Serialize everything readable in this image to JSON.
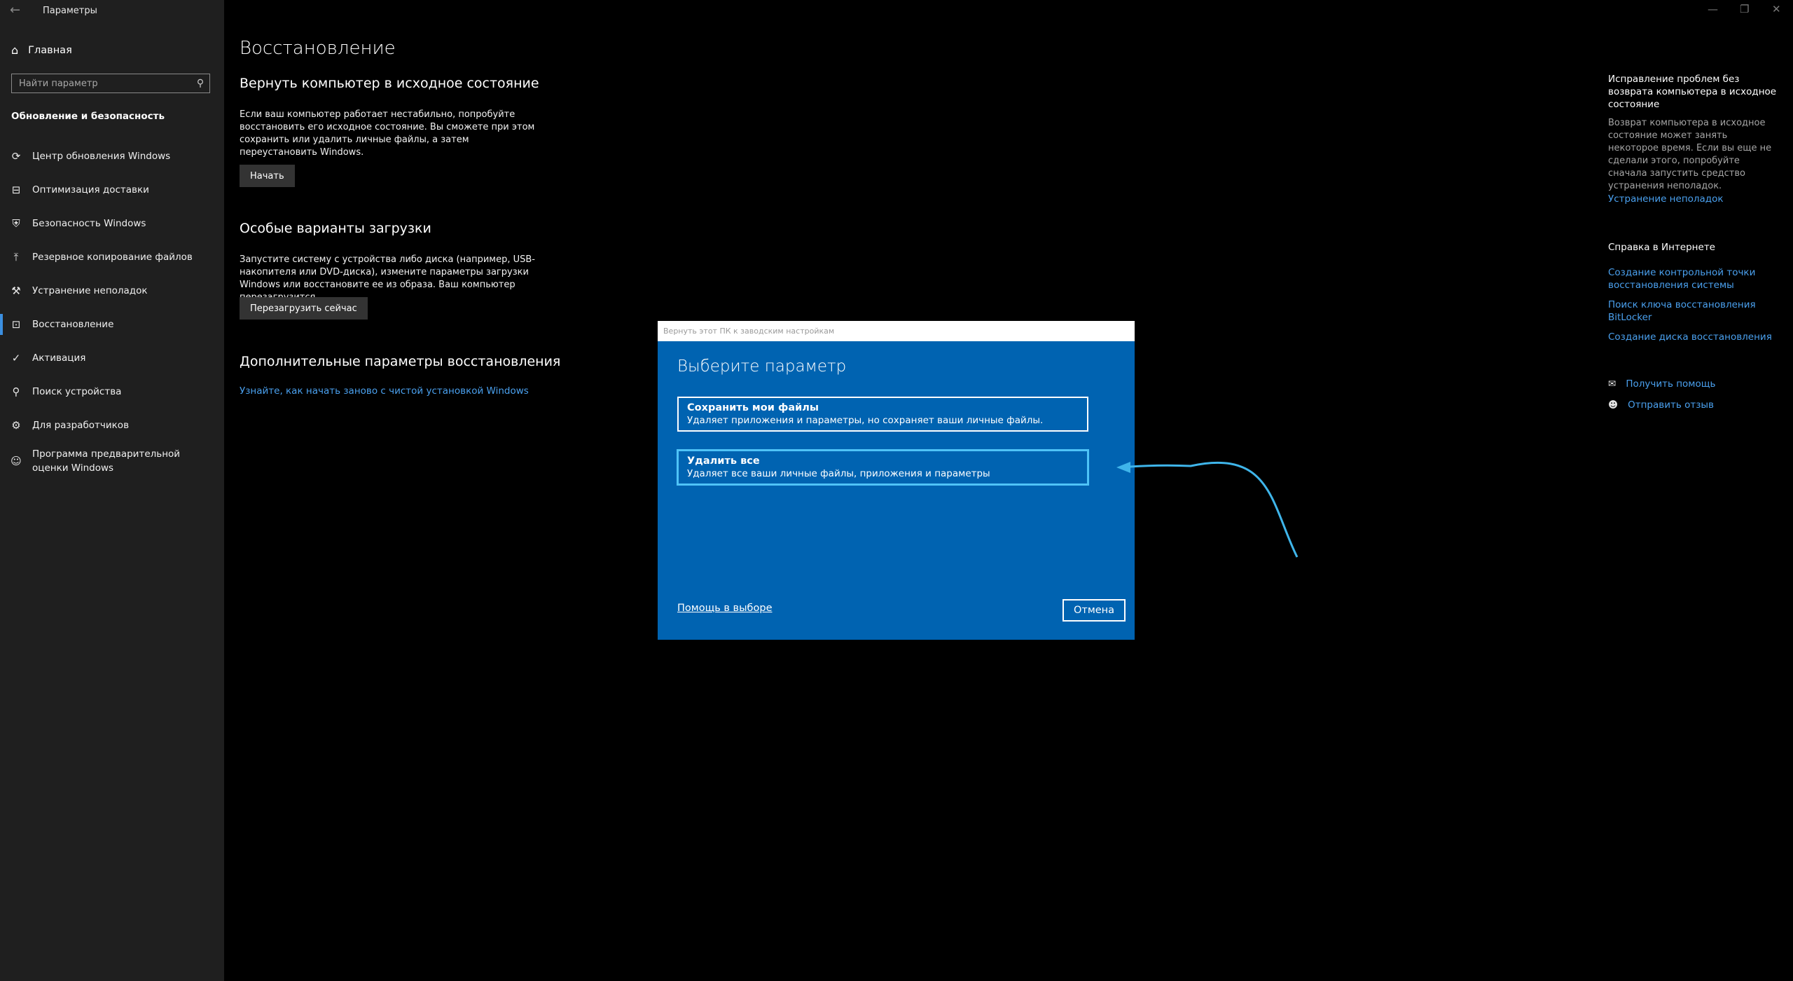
{
  "window": {
    "title": "Параметры",
    "minimize": "—",
    "maximize": "❐",
    "close": "✕",
    "back": "←"
  },
  "sidebar": {
    "home_label": "Главная",
    "search_placeholder": "Найти параметр",
    "section_title": "Обновление и безопасность",
    "items": [
      {
        "label": "Центр обновления Windows",
        "icon": "⟳"
      },
      {
        "label": "Оптимизация доставки",
        "icon": "⊟"
      },
      {
        "label": "Безопасность Windows",
        "icon": "⛨"
      },
      {
        "label": "Резервное копирование файлов",
        "icon": "⤒"
      },
      {
        "label": "Устранение неполадок",
        "icon": "⚒"
      },
      {
        "label": "Восстановление",
        "icon": "⊡"
      },
      {
        "label": "Активация",
        "icon": "✓"
      },
      {
        "label": "Поиск устройства",
        "icon": "⚲"
      },
      {
        "label": "Для разработчиков",
        "icon": "⚙"
      },
      {
        "label": "Программа предварительной оценки Windows",
        "icon": "☺"
      }
    ]
  },
  "main": {
    "title": "Восстановление",
    "reset": {
      "heading": "Вернуть компьютер в исходное состояние",
      "text": "Если ваш компьютер работает нестабильно, попробуйте восстановить его исходное состояние. Вы сможете при этом сохранить или удалить личные файлы, а затем переустановить Windows.",
      "button": "Начать"
    },
    "boot": {
      "heading": "Особые варианты загрузки",
      "text": "Запустите систему с устройства либо диска (например, USB-накопителя или DVD-диска), измените параметры загрузки Windows или восстановите ее из образа. Ваш компьютер перезагрузится.",
      "button": "Перезагрузить сейчас"
    },
    "advanced": {
      "heading": "Дополнительные параметры восстановления",
      "link": "Узнайте, как начать заново с чистой установкой Windows"
    }
  },
  "right_panel": {
    "fix_heading": "Исправление проблем без возврата компьютера в исходное состояние",
    "fix_text": "Возврат компьютера в исходное состояние может занять некоторое время. Если вы еще не сделали этого, попробуйте сначала запустить средство устранения неполадок.",
    "fix_link": "Устранение неполадок",
    "help_heading": "Справка в Интернете",
    "help_links": [
      "Создание контрольной точки восстановления системы",
      "Поиск ключа восстановления BitLocker",
      "Создание диска восстановления"
    ],
    "get_help": "Получить помощь",
    "feedback": "Отправить отзыв"
  },
  "dialog": {
    "title": "Вернуть этот ПК к заводским настройкам",
    "heading": "Выберите параметр",
    "options": [
      {
        "title": "Сохранить мои файлы",
        "desc": "Удаляет приложения и параметры, но сохраняет ваши личные файлы."
      },
      {
        "title": "Удалить все",
        "desc": "Удаляет все ваши личные файлы, приложения и параметры"
      }
    ],
    "help_link": "Помощь в выборе",
    "cancel": "Отмена"
  },
  "colors": {
    "accent": "#0063b1",
    "link": "#4aa0ee",
    "annotation_arrow": "#3fb5ea"
  }
}
